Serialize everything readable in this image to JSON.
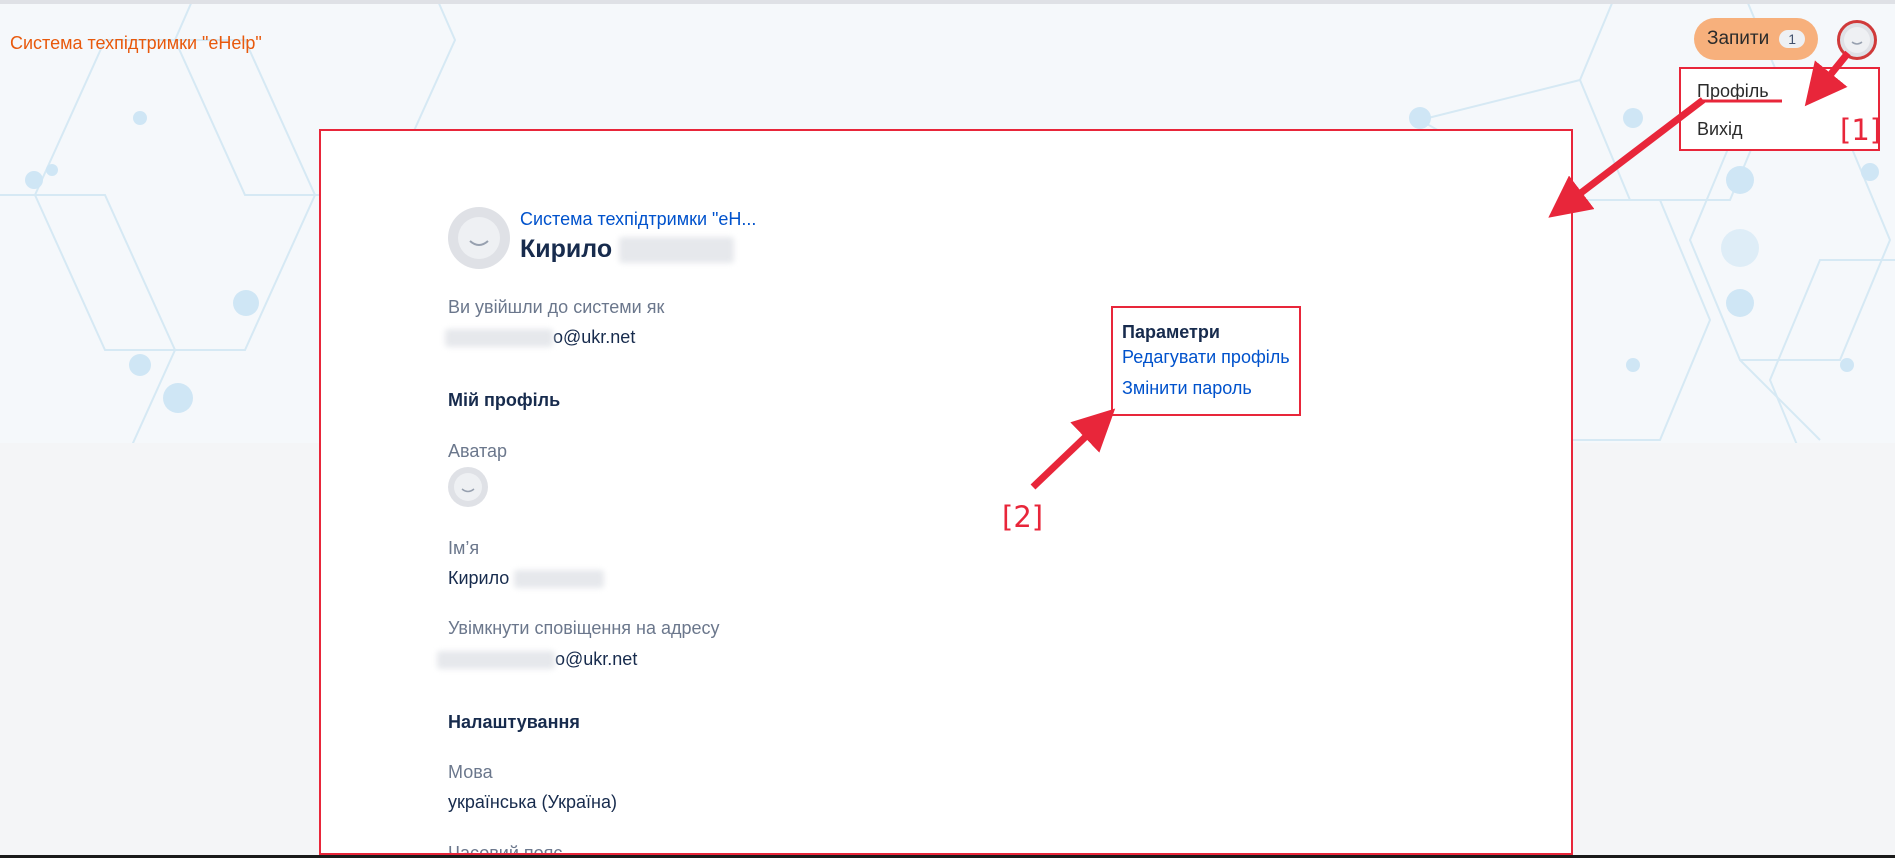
{
  "header": {
    "brand": "Система техпідтримки \"eHelp\"",
    "requests_label": "Запити",
    "requests_count": "1",
    "avatar_icon": "user-avatar-icon"
  },
  "user_menu": {
    "profile": "Профіль",
    "logout": "Вихід"
  },
  "annotations": {
    "marker_1": "[1]",
    "marker_2": "[2]",
    "color": "#e8263a"
  },
  "profile": {
    "org": "Система техпідтримки \"eH...",
    "first_name": "Кирило",
    "logged_in_label": "Ви увійшли до системи як",
    "email_suffix": "o@ukr.net",
    "my_profile_heading": "Мій профіль",
    "avatar_label": "Аватар",
    "name_label": "Ім’я",
    "name_value": "Кирило",
    "notify_label": "Увімкнути сповіщення на адресу",
    "notify_email_suffix": "o@ukr.net",
    "settings_heading": "Налаштування",
    "language_label": "Мова",
    "language_value": "українська (Україна)",
    "timezone_label": "Часовий пояс"
  },
  "parameters": {
    "heading": "Параметри",
    "edit_profile": "Редагувати профіль",
    "change_password": "Змінити пароль"
  },
  "colors": {
    "brand": "#e8590c",
    "link": "#0052cc",
    "requests_button": "#f7b07c"
  }
}
